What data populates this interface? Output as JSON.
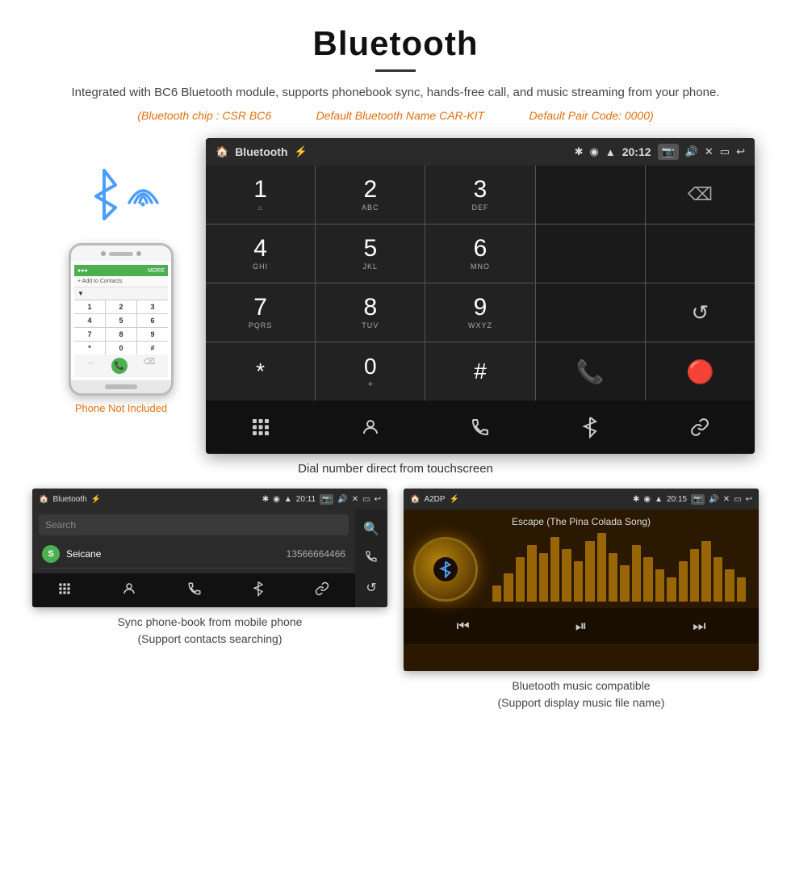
{
  "page": {
    "title": "Bluetooth",
    "divider": true,
    "subtitle": "Integrated with BC6 Bluetooth module, supports phonebook sync, hands-free call, and music streaming from your phone.",
    "chip_info": {
      "chip": "(Bluetooth chip : CSR BC6",
      "name": "Default Bluetooth Name CAR-KIT",
      "code": "Default Pair Code: 0000)"
    }
  },
  "car_screen": {
    "status_bar": {
      "left": "🏠",
      "title": "Bluetooth",
      "usb_icon": "⚡",
      "time": "20:12",
      "icons_right": "📷 🔊 ✕ ▭ ↩"
    },
    "dialpad": {
      "rows": [
        [
          {
            "digit": "1",
            "sub": "⌂"
          },
          {
            "digit": "2",
            "sub": "ABC"
          },
          {
            "digit": "3",
            "sub": "DEF"
          },
          {
            "digit": "",
            "sub": ""
          },
          {
            "digit": "⌫",
            "sub": ""
          }
        ],
        [
          {
            "digit": "4",
            "sub": "GHI"
          },
          {
            "digit": "5",
            "sub": "JKL"
          },
          {
            "digit": "6",
            "sub": "MNO"
          },
          {
            "digit": "",
            "sub": ""
          },
          {
            "digit": "",
            "sub": ""
          }
        ],
        [
          {
            "digit": "7",
            "sub": "PQRS"
          },
          {
            "digit": "8",
            "sub": "TUV"
          },
          {
            "digit": "9",
            "sub": "WXYZ"
          },
          {
            "digit": "",
            "sub": ""
          },
          {
            "digit": "↺",
            "sub": ""
          }
        ],
        [
          {
            "digit": "*",
            "sub": ""
          },
          {
            "digit": "0",
            "sub": "+"
          },
          {
            "digit": "#",
            "sub": ""
          },
          {
            "digit": "📞",
            "sub": "green"
          },
          {
            "digit": "📵",
            "sub": "red"
          }
        ]
      ],
      "bottom_icons": [
        "⊞",
        "👤",
        "📞",
        "✱",
        "🔗"
      ]
    }
  },
  "caption_main": "Dial number direct from touchscreen",
  "phonebook_screen": {
    "status_bar": {
      "left_icon": "🏠",
      "title": "Bluetooth",
      "usb": "⚡",
      "time": "20:11",
      "right_icons": "📷 🔊 ✕ ▭ ↩"
    },
    "search_placeholder": "Search",
    "contacts": [
      {
        "letter": "S",
        "name": "Seicane",
        "number": "13566664466"
      }
    ],
    "right_icons": [
      "🔍",
      "📞",
      "↺"
    ],
    "bottom_icons": [
      "⊞",
      "👤",
      "📞",
      "✱",
      "🔗"
    ]
  },
  "music_screen": {
    "status_bar": {
      "left_icon": "🏠",
      "title": "A2DP",
      "usb": "⚡",
      "time": "20:15",
      "right_icons": "📷 🔊 ✕ ▭ ↩"
    },
    "song_title": "Escape (The Pina Colada Song)",
    "equalizer_bars": [
      20,
      35,
      55,
      70,
      60,
      80,
      65,
      50,
      75,
      85,
      60,
      45,
      70,
      55,
      40,
      30,
      50,
      65,
      75,
      55,
      40,
      30
    ],
    "controls": [
      "⏮",
      "⏯",
      "⏭"
    ]
  },
  "captions": {
    "phone_not_included": "Phone Not Included",
    "phonebook_caption": "Sync phone-book from mobile phone\n(Support contacts searching)",
    "music_caption": "Bluetooth music compatible\n(Support display music file name)"
  },
  "phone_mockup": {
    "keys": [
      "1",
      "2",
      "3",
      "4",
      "5",
      "6",
      "7",
      "8",
      "9",
      "*",
      "0",
      "#"
    ]
  }
}
